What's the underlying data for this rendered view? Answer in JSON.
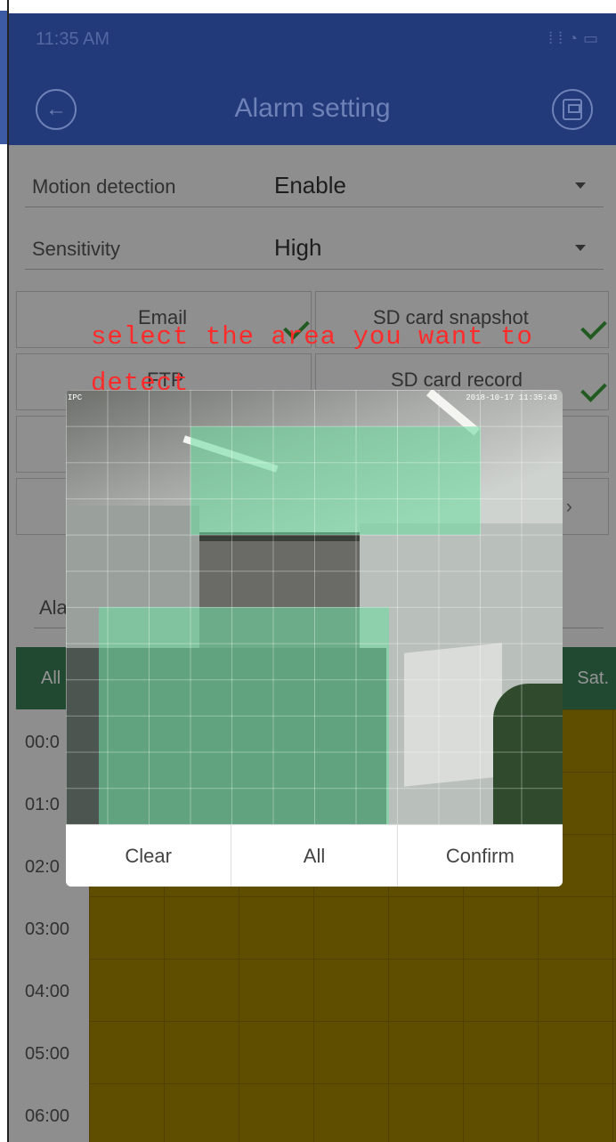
{
  "status_bar": {
    "time": "11:35 AM",
    "icons": [
      "signal-icon",
      "wifi-icon",
      "battery-icon"
    ]
  },
  "app_bar": {
    "title": "Alarm setting",
    "back_icon": "back-arrow-icon",
    "save_icon": "save-disk-icon"
  },
  "settings": {
    "motion_detection": {
      "label": "Motion detection",
      "value": "Enable"
    },
    "sensitivity": {
      "label": "Sensitivity",
      "value": "High"
    }
  },
  "options": {
    "email": {
      "label": "Email",
      "checked": true
    },
    "sd_snapshot": {
      "label": "SD card snapshot",
      "checked": true
    },
    "ftp": {
      "label": "FTP"
    },
    "sd_record": {
      "label": "SD card record",
      "checked": true
    }
  },
  "alarm_schedule": {
    "label_visible": "Ala",
    "header_all": "All",
    "header_sat": "Sat.",
    "times_hidden_partial": [
      "00:0",
      "01:0",
      "02:0"
    ],
    "times": [
      "03:00",
      "04:00",
      "05:00",
      "06:00"
    ]
  },
  "instruction": {
    "text": "select the area you want to detect"
  },
  "camera": {
    "timestamp": "2018-10-17 11:35:43",
    "channel": "IPC"
  },
  "dialog": {
    "clear": "Clear",
    "all": "All",
    "confirm": "Confirm"
  },
  "colors": {
    "appbar": "#223a79",
    "schedule_header": "#3a7f57",
    "schedule_fill": "#a48600",
    "zone": "#6edca0",
    "instruction": "#ff2b2b"
  }
}
